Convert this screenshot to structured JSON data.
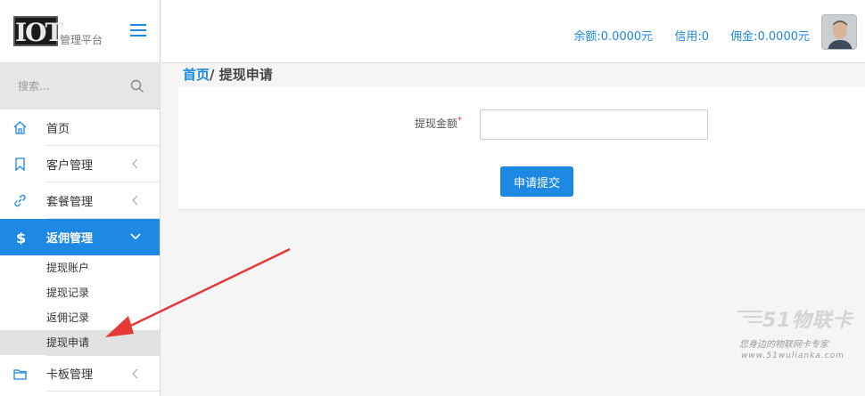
{
  "logo": {
    "mark": "IOT",
    "subtitle": "管理平台"
  },
  "search": {
    "placeholder": "搜索..."
  },
  "sidebar": {
    "items": [
      {
        "label": "首页",
        "icon": "home-icon"
      },
      {
        "label": "客户管理",
        "icon": "bookmark-icon"
      },
      {
        "label": "套餐管理",
        "icon": "link-icon"
      },
      {
        "label": "返佣管理",
        "icon": "dollar-icon",
        "active": true
      },
      {
        "label": "卡板管理",
        "icon": "folder-icon"
      }
    ],
    "subitems": [
      {
        "label": "提现账户"
      },
      {
        "label": "提现记录"
      },
      {
        "label": "返佣记录"
      },
      {
        "label": "提现申请",
        "current": true
      }
    ]
  },
  "header": {
    "balance": "余额:0.0000元",
    "credit": "信用:0",
    "commission": "佣金:0.0000元"
  },
  "breadcrumb": {
    "home": "首页",
    "separator": "/",
    "current": "提现申请"
  },
  "form": {
    "amount_label": "提现金额",
    "required_mark": "*",
    "amount_value": "",
    "submit_label": "申请提交"
  },
  "watermark": {
    "brand": "51物联卡",
    "slogan": "您身边的物联网卡专家",
    "url": "www.51wulianka.com"
  },
  "colors": {
    "accent": "#1e88e5",
    "arrow": "#e53935"
  }
}
